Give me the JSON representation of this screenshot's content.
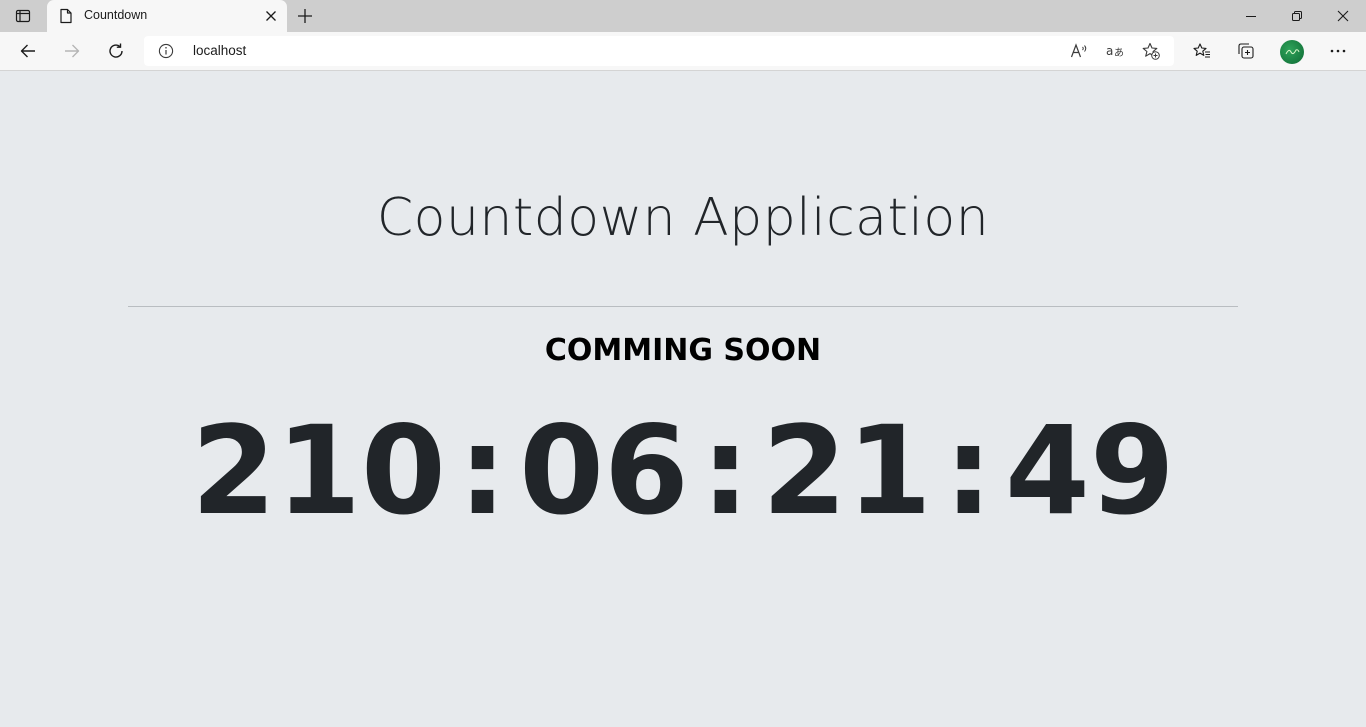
{
  "browser": {
    "tab": {
      "title": "Countdown"
    },
    "address": {
      "url": "localhost"
    },
    "icons": {
      "sidebar": "tab-actions-icon",
      "page": "page-icon",
      "close": "close-icon",
      "new_tab": "plus-icon",
      "back": "back-arrow-icon",
      "forward": "forward-arrow-icon",
      "refresh": "refresh-icon",
      "info": "info-icon",
      "read_aloud": "read-aloud-icon",
      "translate": "translate-icon",
      "add_favorite": "add-favorite-icon",
      "favorites": "favorites-icon",
      "collections": "collections-icon",
      "more": "more-icon",
      "minimize": "minimize-icon",
      "restore": "restore-icon",
      "window_close": "close-icon"
    },
    "colors": {
      "tab_strip": "#cecece",
      "toolbar": "#f7f7f7",
      "avatar": "#17813f"
    }
  },
  "page": {
    "title": "Countdown Application",
    "subtitle": "COMMING SOON",
    "countdown": {
      "days": "210",
      "hours": "06",
      "minutes": "21",
      "seconds": "49",
      "separator": ":"
    },
    "colors": {
      "background": "#e7eaed",
      "text": "#212529"
    }
  }
}
